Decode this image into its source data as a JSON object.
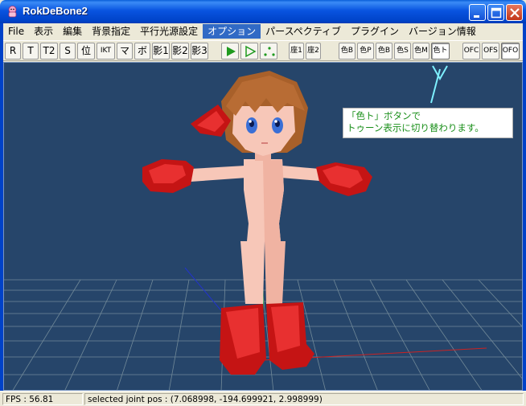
{
  "window": {
    "title": "RokDeBone2"
  },
  "menu": {
    "items": [
      {
        "label": "File"
      },
      {
        "label": "表示"
      },
      {
        "label": "編集"
      },
      {
        "label": "背景指定"
      },
      {
        "label": "平行光源設定"
      },
      {
        "label": "オプション",
        "active": true
      },
      {
        "label": "パースペクティブ"
      },
      {
        "label": "プラグイン"
      },
      {
        "label": "バージョン情報"
      }
    ]
  },
  "toolbar": {
    "mode_buttons": [
      "R",
      "T",
      "T2",
      "S",
      "位",
      "IKT",
      "マ",
      "ボ",
      "影1",
      "影2",
      "影3"
    ],
    "play_icons": [
      "play-solid-icon",
      "play-outline-icon",
      "dots-icon"
    ],
    "coord_buttons": [
      "座1",
      "座2"
    ],
    "color_buttons": [
      "色B",
      "色P",
      "色B",
      "色S",
      "色M",
      "色ト"
    ],
    "ofc_buttons": [
      "OFC",
      "OFS",
      "OFO"
    ]
  },
  "callout": {
    "line1": "「色ト」ボタンで",
    "line2": "トゥーン表示に切り替わります。"
  },
  "colors": {
    "viewport_bg": "#26456a",
    "grid_line": "#8aa0a8",
    "callout_text": "#1a8f1a",
    "arrow": "#7ef0ff",
    "character_red": "#c51414",
    "skin": "#f7c7b8",
    "hair": "#a8602a"
  },
  "status": {
    "fps": "FPS : 56.81",
    "joint_pos": "selected joint pos : (7.068998, -194.699921, 2.998999)"
  }
}
